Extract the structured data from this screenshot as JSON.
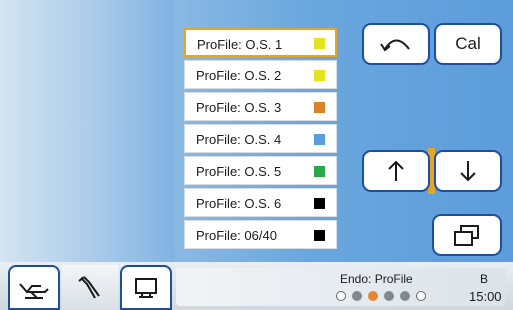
{
  "profiles": [
    {
      "label": "ProFile: O.S. 1",
      "color": "#e3e31e",
      "selected": true
    },
    {
      "label": "ProFile: O.S. 2",
      "color": "#e3e31e",
      "selected": false
    },
    {
      "label": "ProFile: O.S. 3",
      "color": "#d9812b",
      "selected": false
    },
    {
      "label": "ProFile: O.S. 4",
      "color": "#5a9ee0",
      "selected": false
    },
    {
      "label": "ProFile: O.S. 5",
      "color": "#2aa84c",
      "selected": false
    },
    {
      "label": "ProFile: O.S. 6",
      "color": "#000000",
      "selected": false
    },
    {
      "label": "ProFile: 06/40",
      "color": "#000000",
      "selected": false
    }
  ],
  "buttons": {
    "undo_icon": "undo-arrow-icon",
    "cal_label": "Cal",
    "up_icon": "arrow-up-icon",
    "down_icon": "arrow-down-icon",
    "window_icon": "window-restore-icon"
  },
  "tabs": [
    {
      "icon": "dental-chair-icon"
    },
    {
      "icon": "dental-instrument-icon"
    },
    {
      "icon": "monitor-icon"
    }
  ],
  "status": {
    "label": "Endo: ProFile",
    "indicator": "B",
    "time": "15:00",
    "dots": [
      "empty",
      "filled",
      "active",
      "filled",
      "filled",
      "empty"
    ]
  },
  "colors": {
    "accent_border": "#1f4f9c",
    "selection": "#e3a62c"
  }
}
